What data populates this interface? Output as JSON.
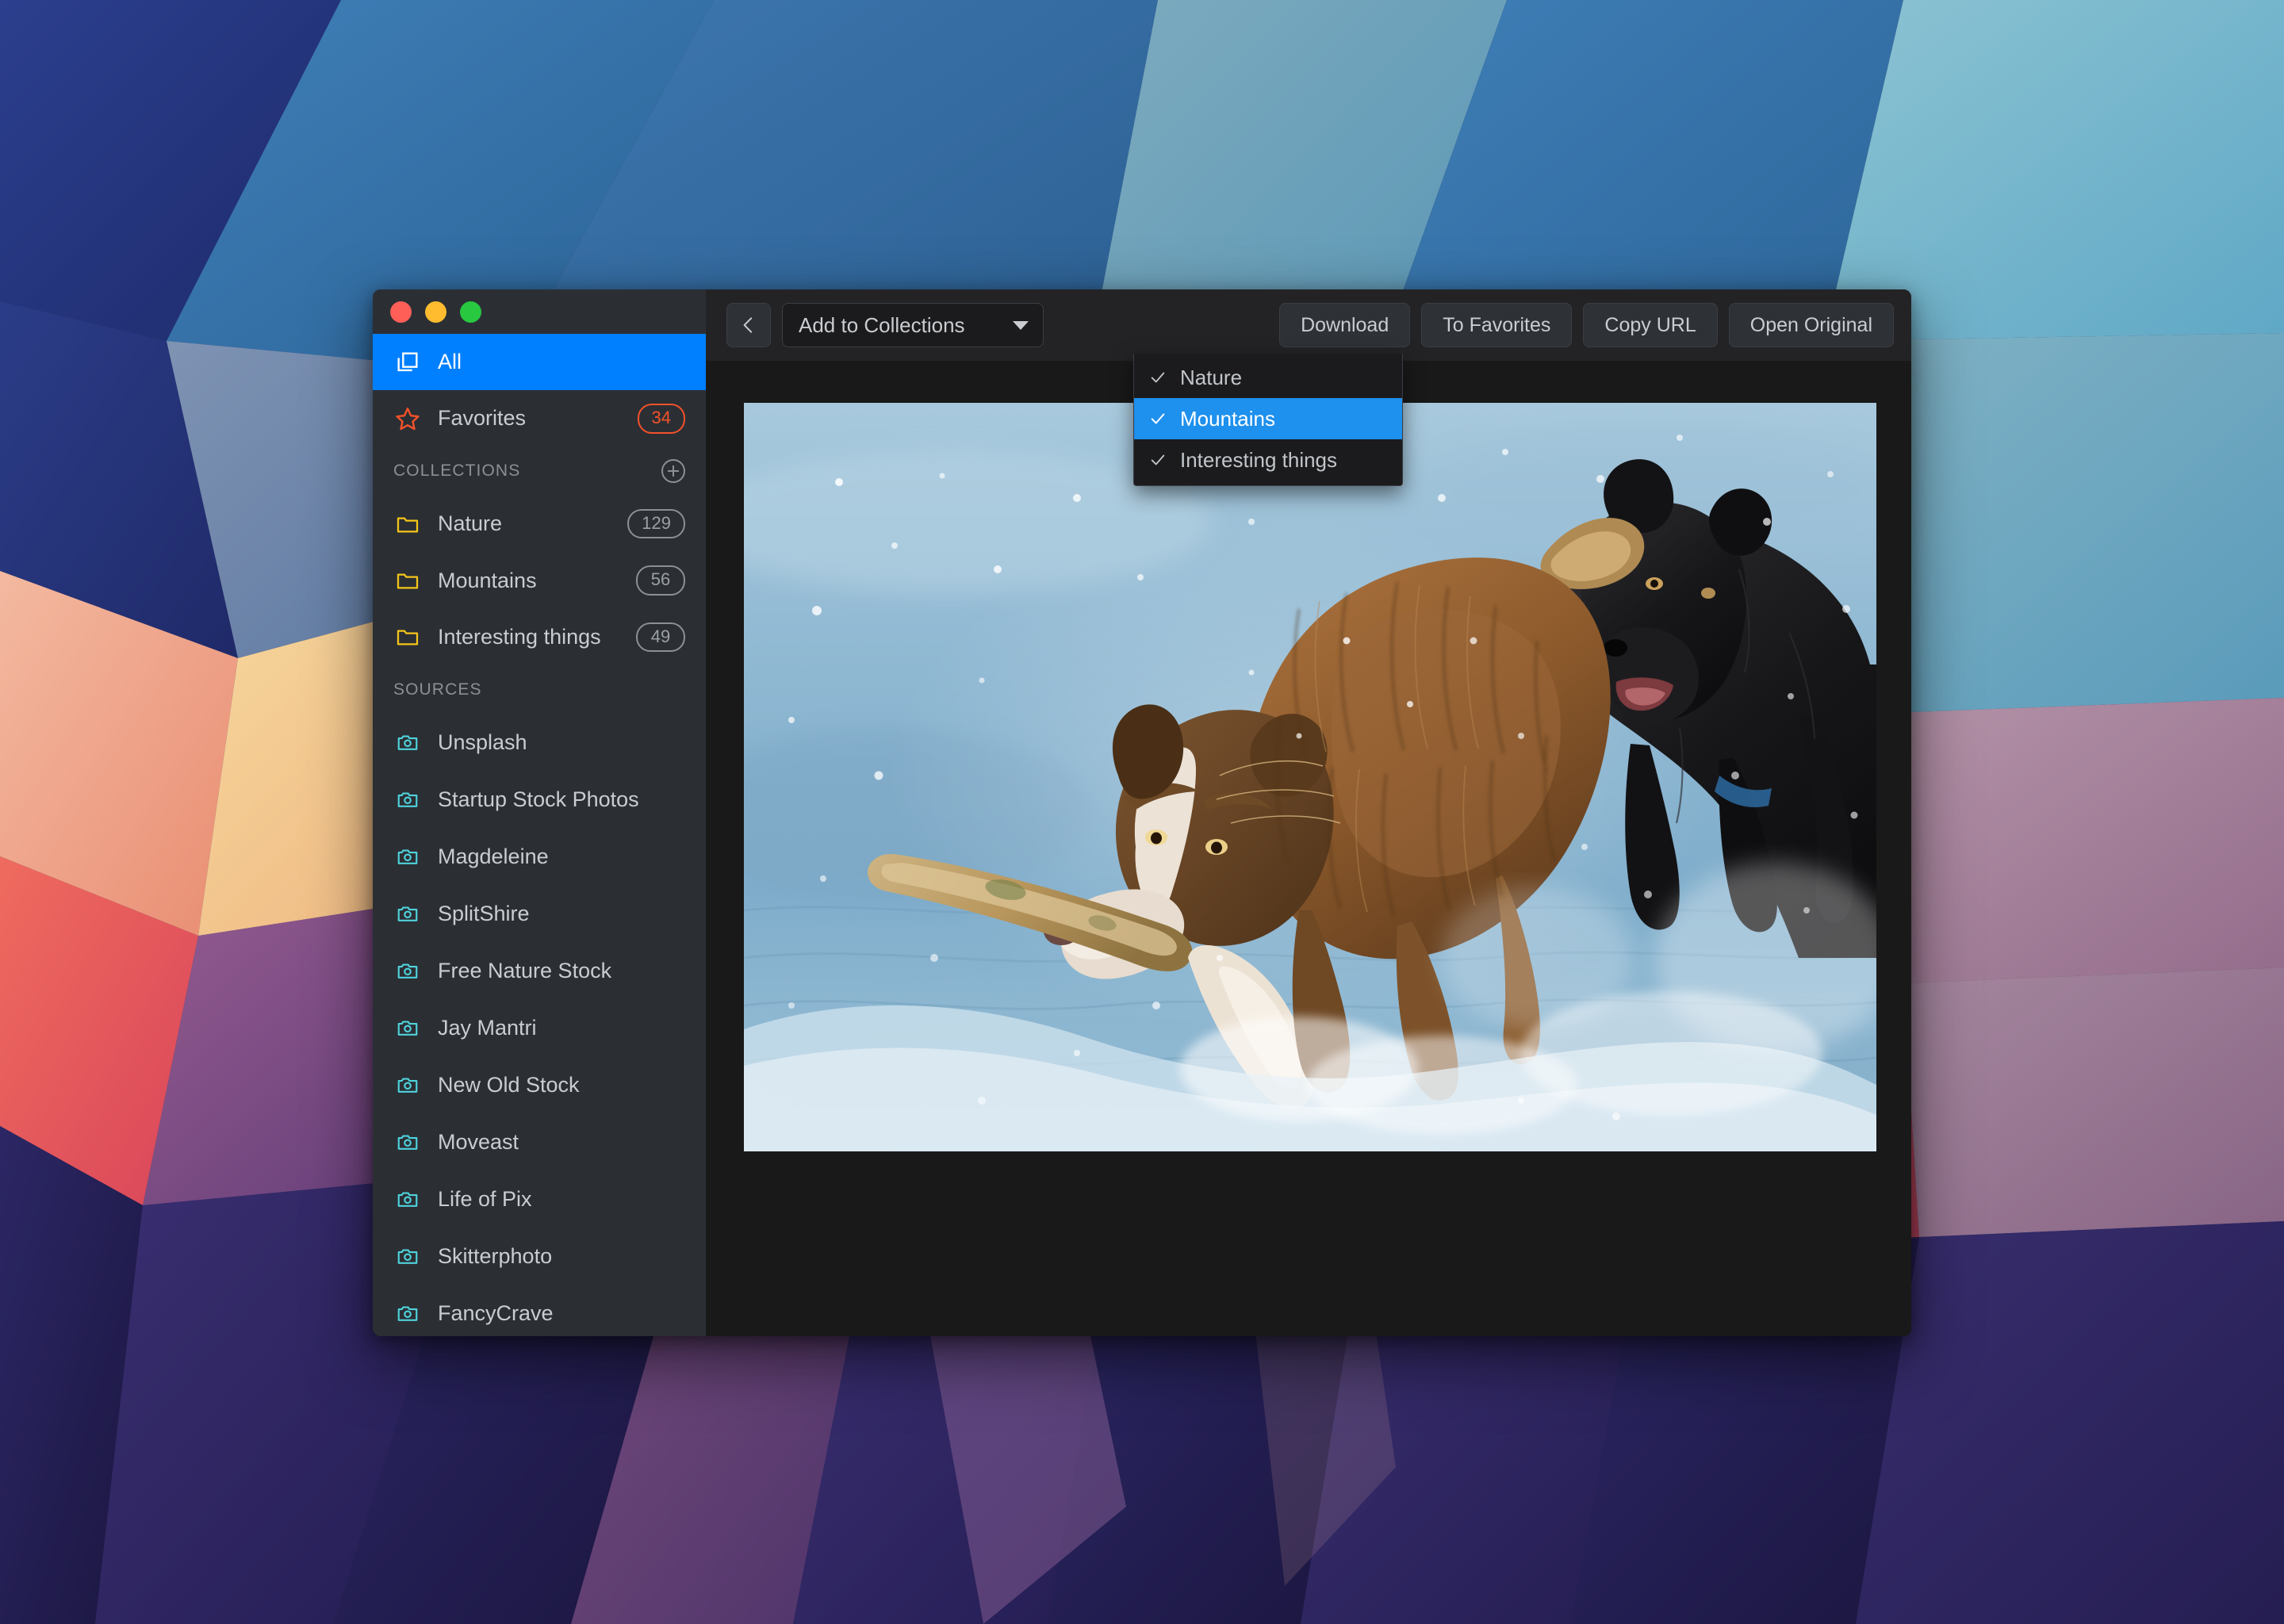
{
  "window": {
    "traffic_lights": [
      {
        "name": "close",
        "color": "#ff5f57"
      },
      {
        "name": "minimize",
        "color": "#febc2e"
      },
      {
        "name": "maximize",
        "color": "#28c840"
      }
    ]
  },
  "sidebar": {
    "primary": [
      {
        "label": "All",
        "icon": "copy-icon",
        "active": true,
        "badge": null
      },
      {
        "label": "Favorites",
        "icon": "star-icon",
        "active": false,
        "badge": "34"
      }
    ],
    "collections_header": {
      "title": "COLLECTIONS",
      "add_icon": "plus-circle-icon"
    },
    "collections": [
      {
        "label": "Nature",
        "badge": "129",
        "icon": "folder-icon"
      },
      {
        "label": "Mountains",
        "badge": "56",
        "icon": "folder-icon"
      },
      {
        "label": "Interesting things",
        "badge": "49",
        "icon": "folder-icon"
      }
    ],
    "sources_header": {
      "title": "SOURCES"
    },
    "sources": [
      {
        "label": "Unsplash",
        "icon": "camera-icon"
      },
      {
        "label": "Startup Stock Photos",
        "icon": "camera-icon"
      },
      {
        "label": "Magdeleine",
        "icon": "camera-icon"
      },
      {
        "label": "SplitShire",
        "icon": "camera-icon"
      },
      {
        "label": "Free Nature Stock",
        "icon": "camera-icon"
      },
      {
        "label": "Jay Mantri",
        "icon": "camera-icon"
      },
      {
        "label": "New Old Stock",
        "icon": "camera-icon"
      },
      {
        "label": "Moveast",
        "icon": "camera-icon"
      },
      {
        "label": "Life of Pix",
        "icon": "camera-icon"
      },
      {
        "label": "Skitterphoto",
        "icon": "camera-icon"
      },
      {
        "label": "FancyCrave",
        "icon": "camera-icon"
      }
    ]
  },
  "toolbar": {
    "back_label": "",
    "back_icon": "chevron-left-icon",
    "collections_select": {
      "label": "Add to Collections",
      "caret_icon": "chevron-down-icon"
    },
    "actions": [
      {
        "label": "Download"
      },
      {
        "label": "To Favorites"
      },
      {
        "label": "Copy URL"
      },
      {
        "label": "Open Original"
      }
    ]
  },
  "dropdown": {
    "open": true,
    "items": [
      {
        "label": "Nature",
        "checked": true,
        "highlighted": false
      },
      {
        "label": "Mountains",
        "checked": true,
        "highlighted": true
      },
      {
        "label": "Interesting things",
        "checked": true,
        "highlighted": false
      }
    ]
  },
  "photo": {
    "alt": "Two wet dogs running through shallow water, the brown one carrying a stick in its mouth",
    "subjects": [
      "brown dog with stick",
      "black dog"
    ]
  },
  "colors": {
    "accent_blue": "#0080ff",
    "highlight_blue": "#1e90ed",
    "favorites_orange": "#f4522a",
    "folder_yellow": "#f5c518",
    "camera_cyan": "#4fd3dd",
    "sidebar_bg": "#2b2f34",
    "main_bg": "#191919",
    "toolbar_bg": "#232326",
    "menu_bg": "#1b1b1d",
    "text_primary": "#c9ccd0",
    "text_muted": "#8b9096"
  }
}
